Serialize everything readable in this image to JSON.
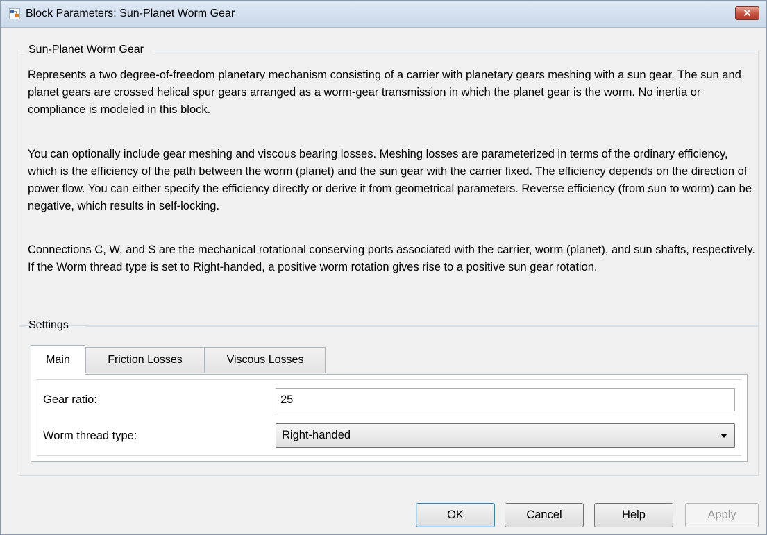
{
  "window": {
    "title": "Block Parameters: Sun-Planet Worm Gear",
    "close_label": "✕"
  },
  "description": {
    "group_title": "Sun-Planet Worm Gear",
    "paragraphs": [
      "Represents a two degree-of-freedom planetary mechanism consisting of a carrier with planetary gears meshing with a sun gear. The sun and planet gears are crossed helical spur gears arranged as a worm-gear transmission in which the planet gear is the worm. No inertia or compliance is modeled in this block.",
      "You can optionally include gear meshing and viscous bearing losses. Meshing losses are parameterized in terms of the ordinary efficiency, which is the efficiency of the path between the worm (planet) and the sun gear with the carrier fixed. The efficiency depends on the direction of power flow. You can either specify the efficiency directly or derive it from geometrical parameters. Reverse efficiency (from sun to worm) can be negative, which results in self-locking.",
      "Connections C, W, and S are the mechanical rotational conserving ports associated with the carrier, worm (planet), and sun shafts, respectively. If the Worm thread type is set to Right-handed, a positive worm rotation gives rise to a positive sun gear rotation."
    ]
  },
  "settings": {
    "group_title": "Settings",
    "tabs": [
      {
        "label": "Main",
        "active": true
      },
      {
        "label": "Friction Losses",
        "active": false
      },
      {
        "label": "Viscous Losses",
        "active": false
      }
    ],
    "fields": {
      "gear_ratio_label": "Gear ratio:",
      "gear_ratio_value": "25",
      "worm_thread_label": "Worm thread type:",
      "worm_thread_value": "Right-handed"
    }
  },
  "buttons": {
    "ok": "OK",
    "cancel": "Cancel",
    "help": "Help",
    "apply": "Apply"
  },
  "icons": {
    "app": "simulink-block-icon",
    "close": "close-icon",
    "dropdown": "chevron-down-icon"
  },
  "colors": {
    "close_button": "#c75040",
    "window_background": "#f0f0f0",
    "default_button_border": "#3c7fb1"
  }
}
